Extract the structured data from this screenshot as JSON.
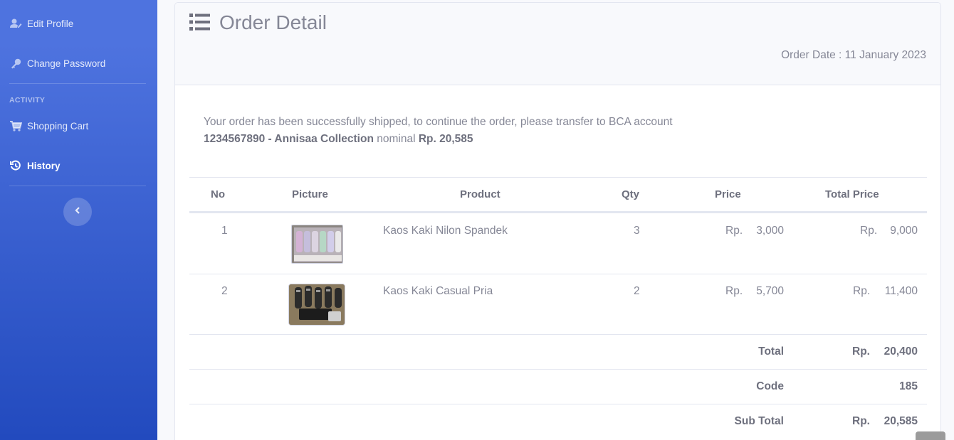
{
  "sidebar": {
    "items": [
      {
        "label": "Edit Profile",
        "icon": "user-edit-icon"
      },
      {
        "label": "Change Password",
        "icon": "key-icon"
      },
      {
        "label": "Shopping Cart",
        "icon": "cart-icon"
      },
      {
        "label": "History",
        "icon": "history-icon",
        "active": true
      }
    ],
    "heading": "ACTIVITY",
    "toggle_icon": "chevron-left-icon"
  },
  "page": {
    "title": "Order Detail",
    "title_icon": "list-icon",
    "order_date_label": "Order Date : ",
    "order_date": "11 January 2023"
  },
  "notice": {
    "text": "Your order has been successfully shipped, to continue the order, please transfer to BCA account",
    "account": "1234567890 - Annisaa Collection",
    "nominal_label": "nominal",
    "nominal": "Rp. 20,585"
  },
  "table": {
    "headers": [
      "No",
      "Picture",
      "Product",
      "Qty",
      "Price",
      "Total Price"
    ],
    "rows": [
      {
        "no": "1",
        "product": "Kaos Kaki Nilon Spandek",
        "qty": "3",
        "price_cur": "Rp.",
        "price": "3,000",
        "total_cur": "Rp.",
        "total": "9,000"
      },
      {
        "no": "2",
        "product": "Kaos Kaki Casual Pria",
        "qty": "2",
        "price_cur": "Rp.",
        "price": "5,700",
        "total_cur": "Rp.",
        "total": "11,400"
      }
    ],
    "summary": {
      "total_label": "Total",
      "total_cur": "Rp.",
      "total": "20,400",
      "code_label": "Code",
      "code": "185",
      "subtotal_label": "Sub Total",
      "subtotal_cur": "Rp.",
      "subtotal": "20,585"
    }
  },
  "colors": {
    "sidebar_start": "#4e73df",
    "sidebar_end": "#224abe",
    "text": "#858796"
  }
}
